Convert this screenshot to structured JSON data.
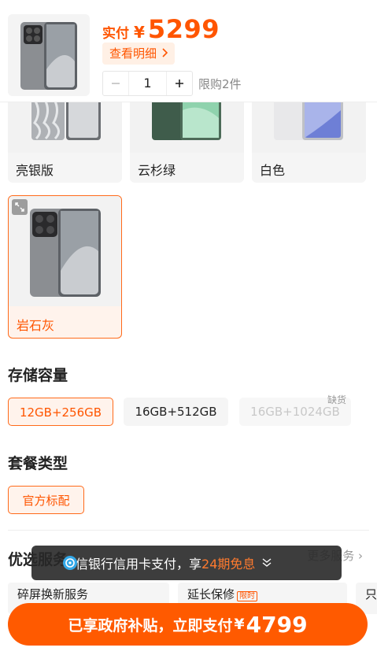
{
  "header": {
    "price_label": "实付",
    "currency": "¥",
    "price": "5299",
    "detail_label": "查看明细",
    "quantity": "1",
    "limit_text": "限购2件"
  },
  "colors": [
    {
      "label": "亮银版"
    },
    {
      "label": "云杉绿"
    },
    {
      "label": "白色"
    },
    {
      "label": "岩石灰"
    }
  ],
  "storage": {
    "title": "存储容量",
    "options": [
      {
        "label": "12GB+256GB"
      },
      {
        "label": "16GB+512GB"
      },
      {
        "label": "16GB+1024GB",
        "badge": "缺货"
      }
    ]
  },
  "package": {
    "title": "套餐类型",
    "options": [
      {
        "label": "官方标配"
      }
    ]
  },
  "services": {
    "title": "优选服务",
    "more_label": "更多服务",
    "cards": [
      {
        "label": "碎屏换新服务"
      },
      {
        "label": "延长保修",
        "tag": "限时"
      },
      {
        "label": "只换"
      }
    ]
  },
  "toast": {
    "prefix": "中信银行信用卡支付，享",
    "highlight": "24期免息"
  },
  "cta": {
    "text": "已享政府补贴，立即支付",
    "currency": "¥",
    "amount": "4799"
  }
}
